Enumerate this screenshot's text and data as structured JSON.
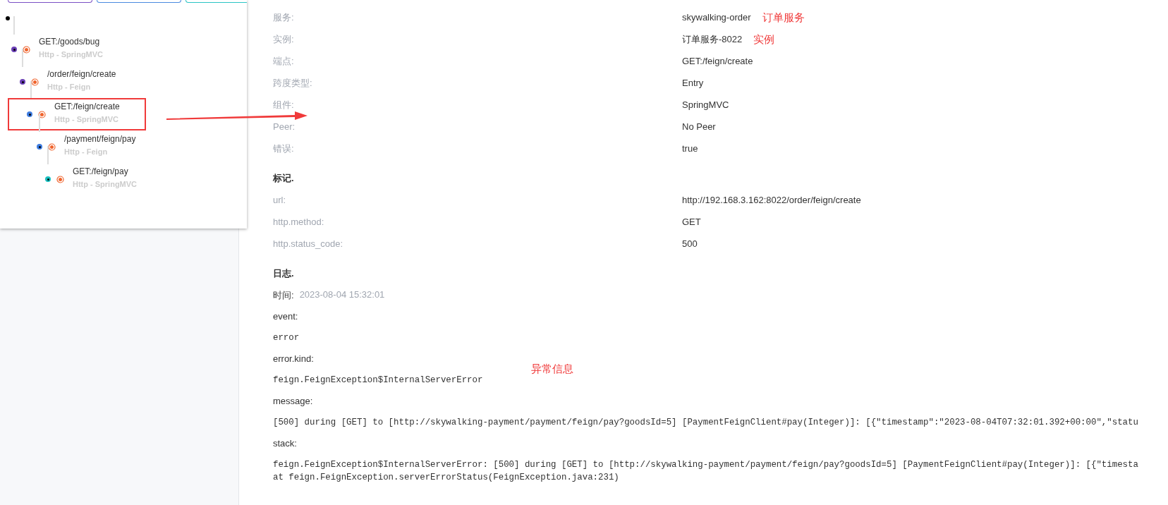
{
  "tabs": [
    {
      "color": "#7b4fc4"
    },
    {
      "color": "#4a8ae0"
    },
    {
      "color": "#2ac4c4"
    }
  ],
  "trace_tree": {
    "children": [
      {
        "label": "GET:/goods/bug",
        "detail": "Http - SpringMVC",
        "color": "#6a3fb5",
        "marked": false,
        "children": [
          {
            "label": "/order/feign/create",
            "detail": "Http - Feign",
            "color": "#6a3fb5",
            "marked": false,
            "children": [
              {
                "label": "GET:/feign/create",
                "detail": "Http - SpringMVC",
                "color": "#3f7de0",
                "marked": true,
                "children": [
                  {
                    "label": "/payment/feign/pay",
                    "detail": "Http - Feign",
                    "color": "#3f7de0",
                    "marked": false,
                    "children": [
                      {
                        "label": "GET:/feign/pay",
                        "detail": "Http - SpringMVC",
                        "color": "#19bfbf",
                        "marked": false
                      }
                    ]
                  }
                ]
              }
            ]
          }
        ]
      }
    ]
  },
  "span_info": [
    {
      "label": "服务:",
      "value": "skywalking-order",
      "note": "订单服务"
    },
    {
      "label": "实例:",
      "value": "订单服务-8022",
      "note": "实例"
    },
    {
      "label": "端点:",
      "value": "GET:/feign/create"
    },
    {
      "label": "跨度类型:",
      "value": "Entry"
    },
    {
      "label": "组件:",
      "value": "SpringMVC"
    },
    {
      "label": "Peer:",
      "value": "No Peer"
    },
    {
      "label": "错误:",
      "value": "true"
    }
  ],
  "tags": {
    "title": "标记.",
    "rows": [
      {
        "label": "url:",
        "value": "http://192.168.3.162:8022/order/feign/create"
      },
      {
        "label": "http.method:",
        "value": "GET"
      },
      {
        "label": "http.status_code:",
        "value": "500"
      }
    ]
  },
  "logs": {
    "title": "日志.",
    "time_label": "时间:",
    "time": "2023-08-04 15:32:01",
    "note": "异常信息",
    "entries": [
      {
        "key": "event:",
        "lines": [
          "error"
        ]
      },
      {
        "key": "error.kind:",
        "lines": [
          "feign.FeignException$InternalServerError"
        ]
      },
      {
        "key": "message:",
        "lines": [
          "[500] during [GET] to [http://skywalking-payment/payment/feign/pay?goodsId=5] [PaymentFeignClient#pay(Integer)]: [{\"timestamp\":\"2023-08-04T07:32:01.392+00:00\",\"statu"
        ]
      },
      {
        "key": "stack:",
        "lines": [
          "feign.FeignException$InternalServerError: [500] during [GET] to [http://skywalking-payment/payment/feign/pay?goodsId=5] [PaymentFeignClient#pay(Integer)]: [{\"timesta",
          "at feign.FeignException.serverErrorStatus(FeignException.java:231)"
        ]
      }
    ]
  }
}
